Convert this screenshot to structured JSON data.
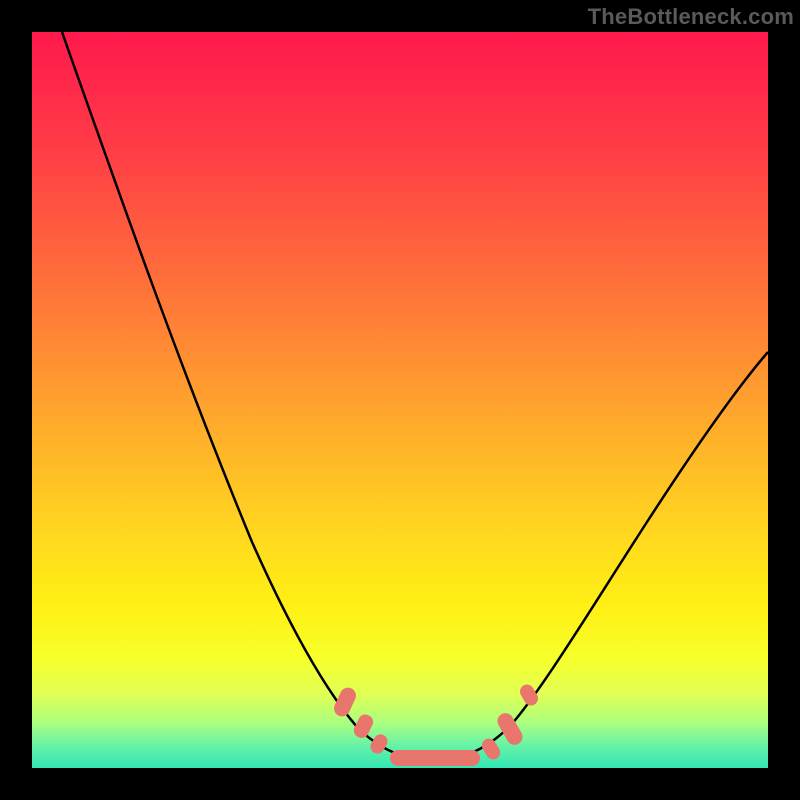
{
  "watermark": "TheBottleneck.com",
  "colors": {
    "frame": "#000000",
    "gradient_top": "#ff1a4d",
    "gradient_bottom": "#33e6b3",
    "curve": "#000000",
    "marker": "#e8766d"
  },
  "chart_data": {
    "type": "line",
    "title": "",
    "xlabel": "",
    "ylabel": "",
    "xlim": [
      0,
      1
    ],
    "ylim": [
      0,
      1
    ],
    "x": [
      0.0,
      0.05,
      0.1,
      0.15,
      0.2,
      0.25,
      0.3,
      0.35,
      0.4,
      0.43,
      0.46,
      0.49,
      0.52,
      0.55,
      0.58,
      0.61,
      0.64,
      0.67,
      0.72,
      0.78,
      0.85,
      0.92,
      1.0
    ],
    "values": [
      1.0,
      0.88,
      0.76,
      0.64,
      0.52,
      0.41,
      0.3,
      0.2,
      0.11,
      0.07,
      0.04,
      0.02,
      0.01,
      0.01,
      0.01,
      0.02,
      0.04,
      0.08,
      0.16,
      0.26,
      0.37,
      0.47,
      0.56
    ],
    "markers": {
      "x": [
        0.42,
        0.445,
        0.47,
        0.5,
        0.53,
        0.56,
        0.59,
        0.625,
        0.65,
        0.665
      ],
      "y": [
        0.085,
        0.06,
        0.04,
        0.02,
        0.012,
        0.012,
        0.02,
        0.045,
        0.075,
        0.095
      ]
    },
    "note": "x,y normalized to plot-area; y=0 is the bottom (minimum bottleneck), y=1 is top."
  }
}
